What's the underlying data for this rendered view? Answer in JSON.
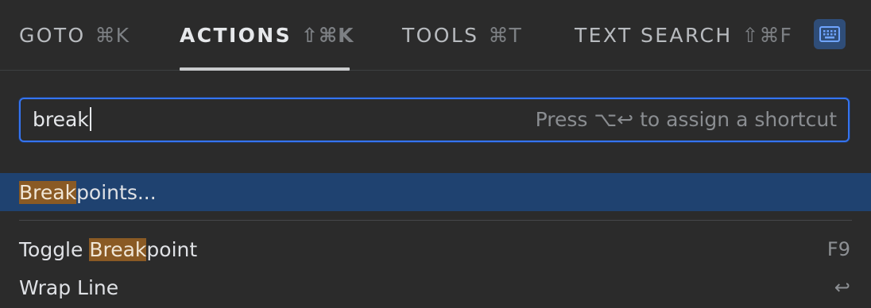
{
  "tabs": [
    {
      "label": "GOTO",
      "shortcut": "⌘K"
    },
    {
      "label": "ACTIONS",
      "shortcut": "⇧⌘K"
    },
    {
      "label": "TOOLS",
      "shortcut": "⌘T"
    },
    {
      "label": "TEXT SEARCH",
      "shortcut": "⇧⌘F"
    }
  ],
  "active_tab": "ACTIONS",
  "keyboard_button_icon": "keyboard-icon",
  "search": {
    "value": "break",
    "hint": "Press ⌥↩ to assign a shortcut"
  },
  "results": [
    {
      "highlight": "Break",
      "rest": "points...",
      "shortcut": "",
      "selected": true
    },
    {
      "prefix": "Toggle ",
      "highlight": "Break",
      "rest": "point",
      "shortcut": "F9",
      "selected": false
    },
    {
      "prefix": "Wrap Line",
      "highlight": "",
      "rest": "",
      "shortcut": "↩",
      "selected": false
    }
  ],
  "colors": {
    "background": "#2b2b2b",
    "accent": "#3574f0",
    "selection": "#1f4270",
    "match_highlight": "#8a5a24"
  }
}
